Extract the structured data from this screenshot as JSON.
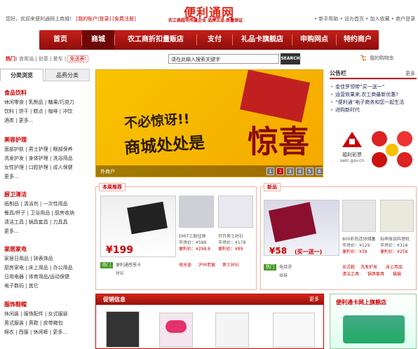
{
  "header": {
    "welcome_prefix": "您好，欢迎来便利通网上商城！",
    "my_account": "[我的账户",
    "login": "登录]",
    "register": "[免费注册]",
    "logo": "便利通网",
    "logo_sub": "农工商超市所属企业 品牌正品 质量保证",
    "links": [
      "新手帮助",
      "设为首页",
      "加入收藏",
      "商户登录"
    ]
  },
  "nav": {
    "items": [
      "首页",
      "商城",
      "农工商折扣量贩店",
      "支付",
      "礼品卡旗舰店",
      "申购网点",
      "特约商户"
    ],
    "active_index": 1
  },
  "hot": {
    "label": "热门:",
    "items": [
      "食用油",
      "创意",
      "爱车",
      "免送表!"
    ]
  },
  "search": {
    "value": "请在此输入搜索关键字",
    "button": "SEARCH"
  },
  "cart": {
    "label": "我的购物车"
  },
  "sidebar": {
    "tabs": [
      "分类浏览",
      "品费分类"
    ],
    "categories": [
      {
        "title": "食品饮料",
        "lines": [
          "休闲零食 | 乳制品 | 糖果/巧克力",
          "饮料 | 饼干 | 糕点 | 咖啡 | 冲饮",
          "酒类 | 更多..."
        ]
      },
      {
        "title": "美容护理",
        "lines": [
          "面部护肤 | 男士护理 | 眼部保养",
          "洗发护发 | 身体护理 | 洗浴用品",
          "女性护理 | 口腔护理 | 成人保健",
          "更多..."
        ]
      },
      {
        "title": "厨卫清洁",
        "lines": [
          "纸制品 | 清洁剂 | 一次性用品",
          "餐具/杯子 | 卫浴用品 | 厨房收纳",
          "清洁工具 | 锅具套具 | 刀具具",
          "更多..."
        ]
      },
      {
        "title": "家居家电",
        "lines": [
          "家居日用品 | 钟表饰品",
          "厨房家电 | 床上用品 | 办公用品",
          "日用电器 | 体育用品/运动保健",
          "电子数码 | 其它"
        ]
      },
      {
        "title": "服饰鞋帽",
        "lines": [
          "休闲装 | 服饰配件 | 女式服装",
          "男式服装 | 男鞋 | 皮带箱包",
          "棉衣 | 西服 | 休闲裤 | 更多..."
        ]
      }
    ]
  },
  "banner": {
    "line1": "不必惊讶!!",
    "line2": "商城处处是",
    "line3": "惊喜",
    "caption": "外商户",
    "pages": [
      "1",
      "2",
      "3",
      "4",
      "5",
      "6"
    ],
    "active_page": 2
  },
  "news": {
    "title": "公告栏",
    "more": "更多",
    "items": [
      "金佳罗领带“买一送一”",
      "运营效果来,农工商最新优惠?",
      "“便利通”电子商务和您一起生活",
      "进购新时代"
    ],
    "lottery_label": "福利彩票",
    "lottery_url": "swlc.gov.cn"
  },
  "weekly": {
    "caption": "本周推荐",
    "main_price": "¥199",
    "main_name": "便利通感恩卡",
    "main_tag": "热门",
    "sub_label": "衬衫",
    "p1_name": "EMIT三联挂钟",
    "p1_market": "市场价：¥588",
    "p1_ours": "便利价：¥298.8",
    "p2_name": "开开男士衬衫",
    "p2_market": "市场价：¥178",
    "p2_ours": "便利价：¥89",
    "tags": [
      "电水壶",
      "泸州老窖",
      "男士衬衫"
    ]
  },
  "newp": {
    "caption": "新品",
    "main_price": "¥58",
    "main_promo": "(买一送一)",
    "main_name": "电烧烫",
    "main_tag": "热门",
    "sub_label": "丝袜",
    "p1_name": "800彩色连体储蓄",
    "p1_market": "市场价：¥129",
    "p1_ours": "便利价：¥39",
    "p2_name": "灿坤食品料理机",
    "p2_market": "市场价：¥318",
    "p2_ours": "便利价：¥258",
    "tags": [
      "女式鞋",
      "洗发护发",
      "床上用品",
      "清洁工具",
      "锅具套具",
      "猫猫"
    ]
  },
  "promo": {
    "title": "促销信息",
    "more": "更多"
  },
  "ad": {
    "title": "便利通卡网上旗舰店"
  },
  "colors": {
    "brand": "#c4201a",
    "accent": "#c00"
  }
}
